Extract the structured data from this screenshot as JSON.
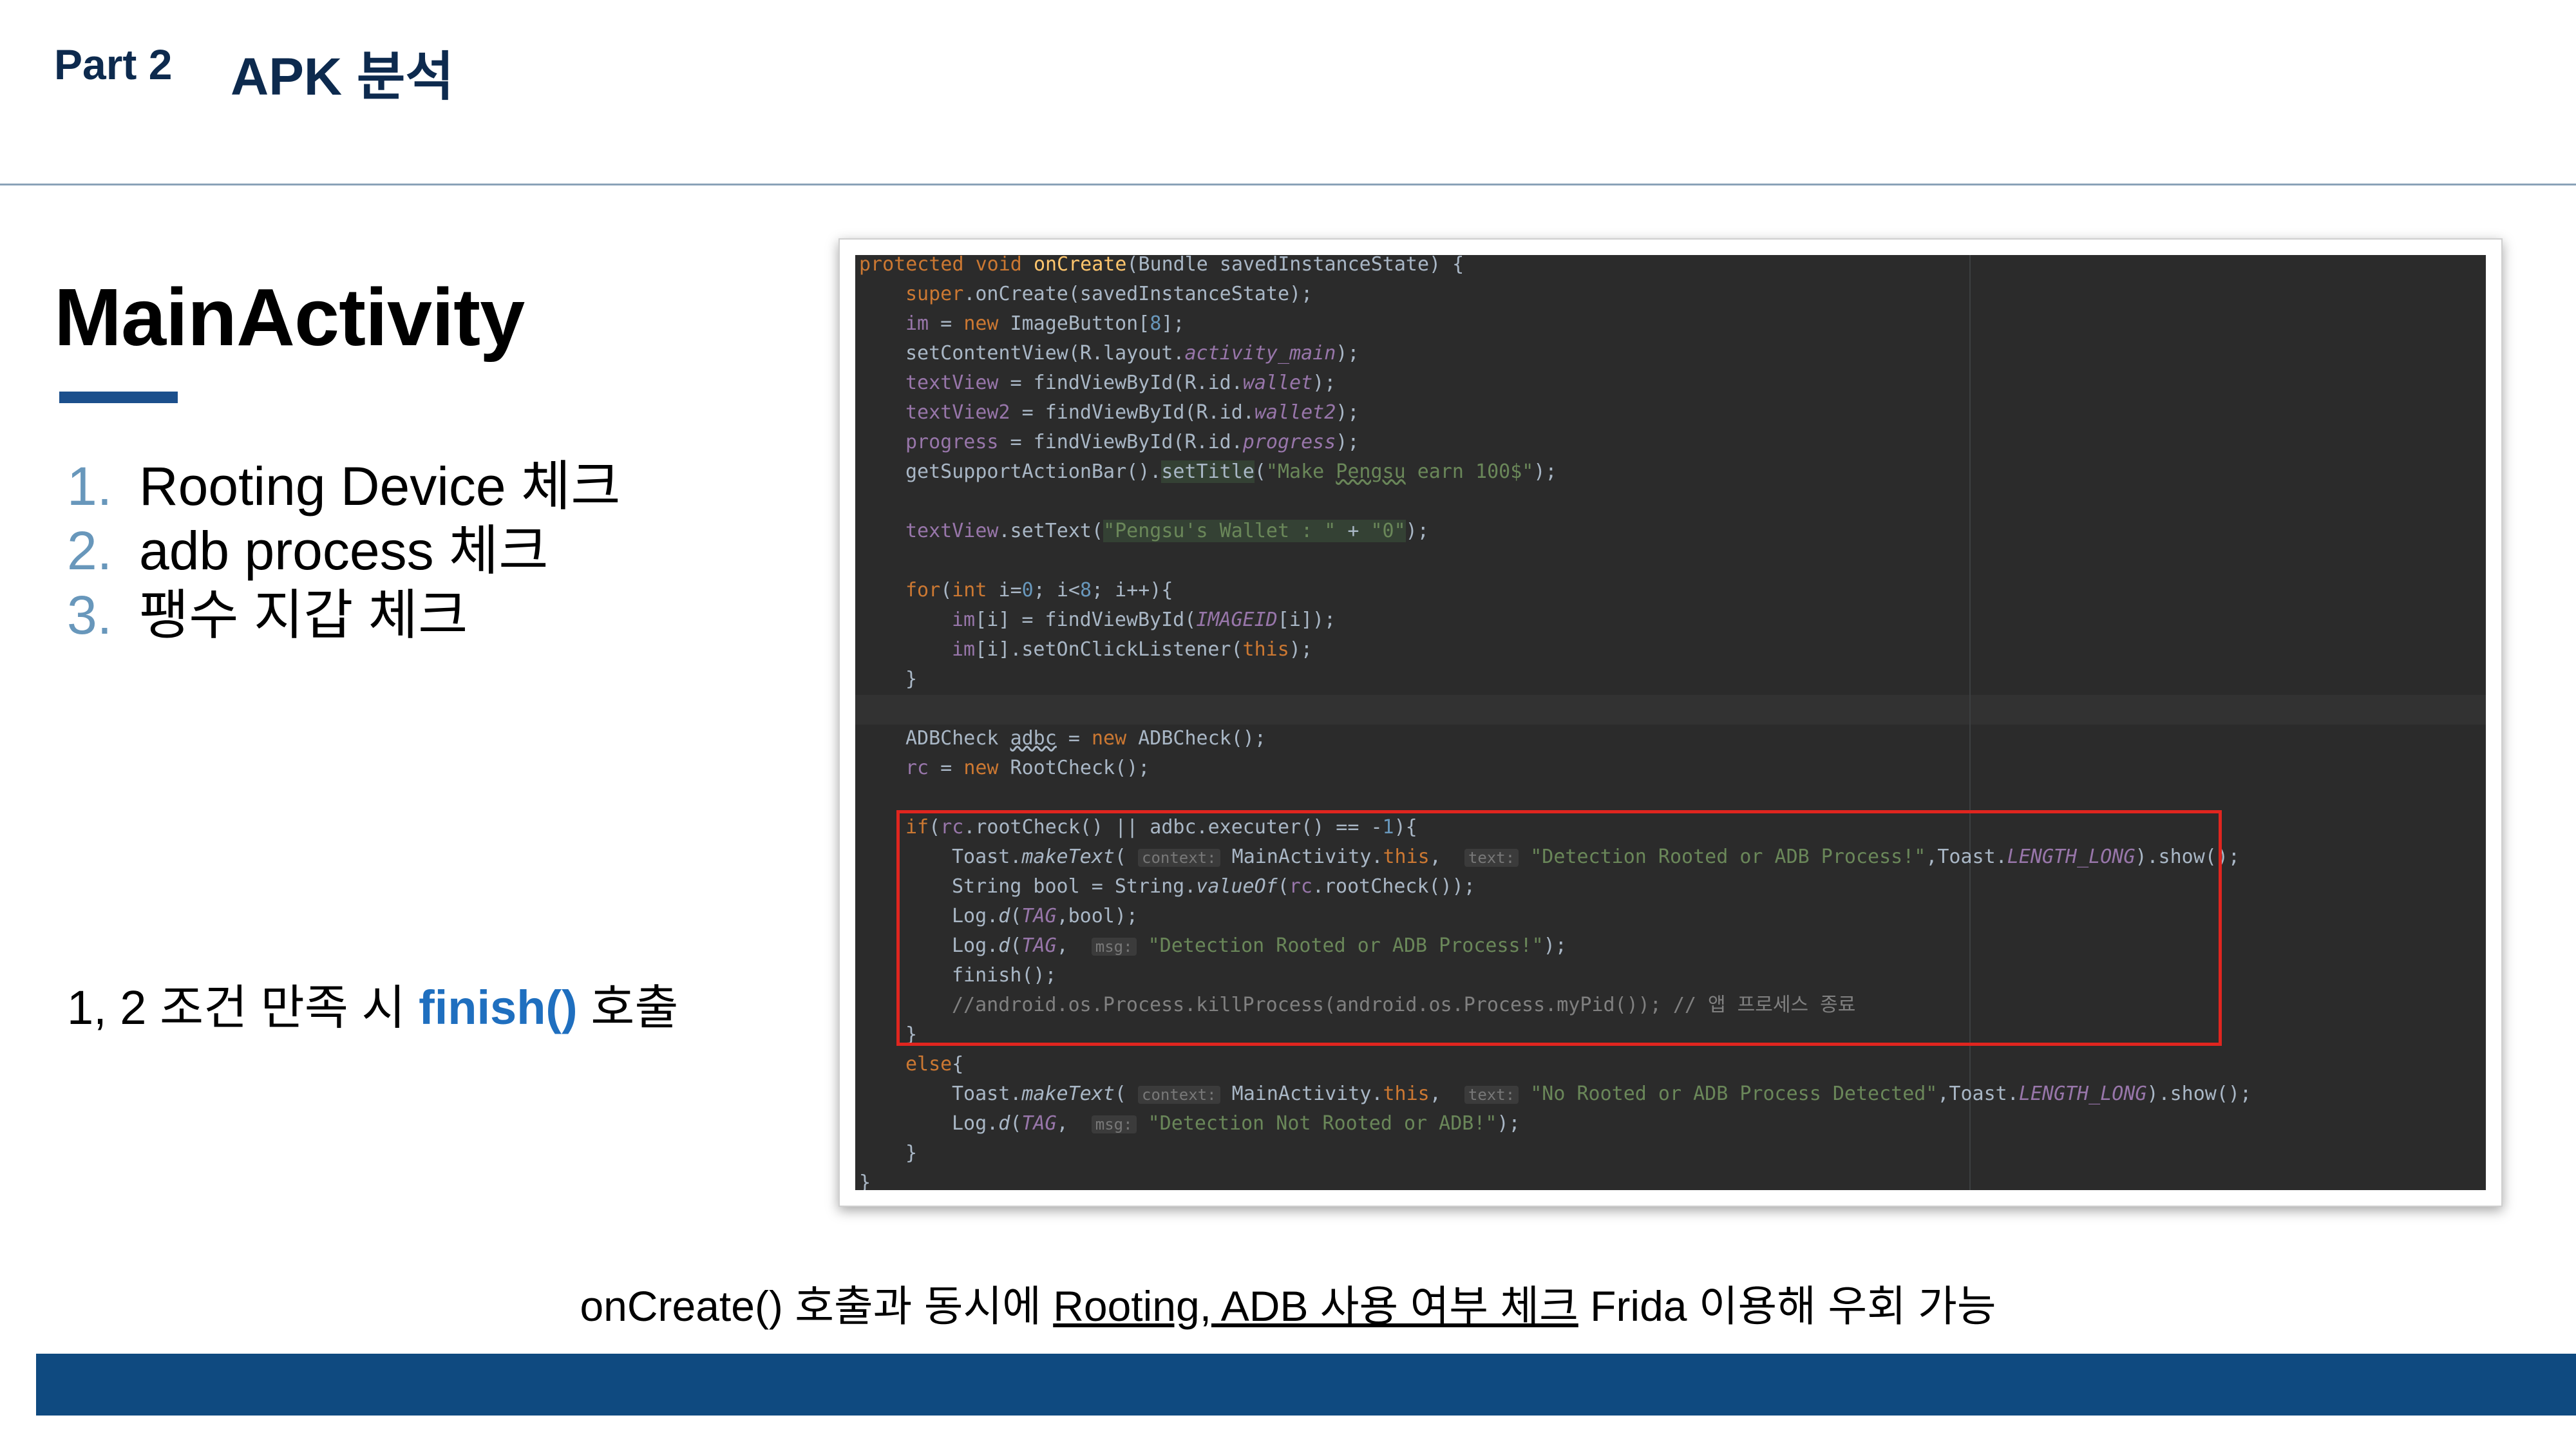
{
  "header": {
    "part": "Part 2",
    "title": "APK 분석"
  },
  "main": {
    "title": "MainActivity",
    "checklist": [
      {
        "num": "1.",
        "text": "Rooting Device 체크"
      },
      {
        "num": "2.",
        "text": "adb process 체크"
      },
      {
        "num": "3.",
        "text": "팽수 지갑 체크"
      }
    ],
    "condition": {
      "prefix": "1, 2 조건 만족 시 ",
      "function": "finish()",
      "suffix": " 호출"
    }
  },
  "code": {
    "line1": {
      "kw": "protected void ",
      "method": "onCreate",
      "rest": "(Bundle savedInstanceState) {"
    },
    "l_super": "super",
    "l_oncreate": ".onCreate(savedInstanceState);",
    "l_im": "im",
    "l_new": "new",
    "l_imagebutton": " ImageButton[",
    "l_eight": "8",
    "l_setcontent": "setContentView(R.layout.",
    "l_activity_main": "activity_main",
    "l_textview": "textView",
    "l_find_wallet": " = findViewById(R.id.",
    "l_wallet": "wallet",
    "l_textview2": "textView2",
    "l_wallet2": "wallet2",
    "l_progress": "progress",
    "l_getsupport": "getSupportActionBar().",
    "l_settitle": "setTitle",
    "l_title_str_a": "\"Make ",
    "l_pengsu": "Pengsu",
    "l_title_str_b": " earn 100$\"",
    "l_settext": ".setText(",
    "l_wallet_str": "\"Pengsu's Wallet : \"",
    "l_plus": "+ ",
    "l_zero_str": "\"0\"",
    "l_for": "for",
    "l_int": "int ",
    "l_i": "i",
    "l_zero": "0",
    "l_lt": "<",
    "l_findimg": "findViewById(",
    "l_imageid": "IMAGEID",
    "l_setonclick": ".setOnClickListener(",
    "l_this": "this",
    "l_adbcheck": "ADBCheck ",
    "l_adbc": "adbc",
    "l_adbcheck_ctor": " ADBCheck();",
    "l_rc": "rc",
    "l_rootcheck_ctor": " RootCheck();",
    "l_if": "if",
    "l_rootcheck_call": ".rootCheck() || adbc.executer() == -",
    "l_one": "1",
    "l_toast": "Toast.",
    "l_maketext": "makeText",
    "l_hint_context": "context:",
    "l_mainactivity": " MainActivity.",
    "l_hint_text": "text:",
    "l_detect_str": "\"Detection Rooted or ADB Process!\"",
    "l_toast_len": ",Toast.",
    "l_length_long": "LENGTH_LONG",
    "l_show": ").show();",
    "l_string_bool": "String bool = String.",
    "l_valueof": "valueOf",
    "l_rootcheck_end": ".rootCheck());",
    "l_log": "Log.",
    "l_d": "d",
    "l_tag": "TAG",
    "l_bool_end": ",bool);",
    "l_hint_msg": "msg:",
    "l_detect_log": "\"Detection Rooted or ADB Process!\"",
    "l_finish": "finish();",
    "l_comment": "//android.os.Process.killProcess(android.os.Process.myPid()); // 앱 프로세스 종료",
    "l_close": "}",
    "l_else": "else",
    "l_no_root_str": "\"No Rooted or ADB Process Detected\"",
    "l_not_root_log": "\"Detection Not Rooted or ADB!\""
  },
  "footnote": {
    "prefix": "onCreate() 호출과 동시에 ",
    "underlined": "Rooting, ADB 사용 여부 체크",
    "suffix": " Frida 이용해 우회 가능"
  },
  "colors": {
    "accent_blue": "#1b4f8c",
    "footer_bar": "#0f4a80",
    "highlight_box": "#e0251f",
    "code_bg": "#2b2b2b"
  }
}
